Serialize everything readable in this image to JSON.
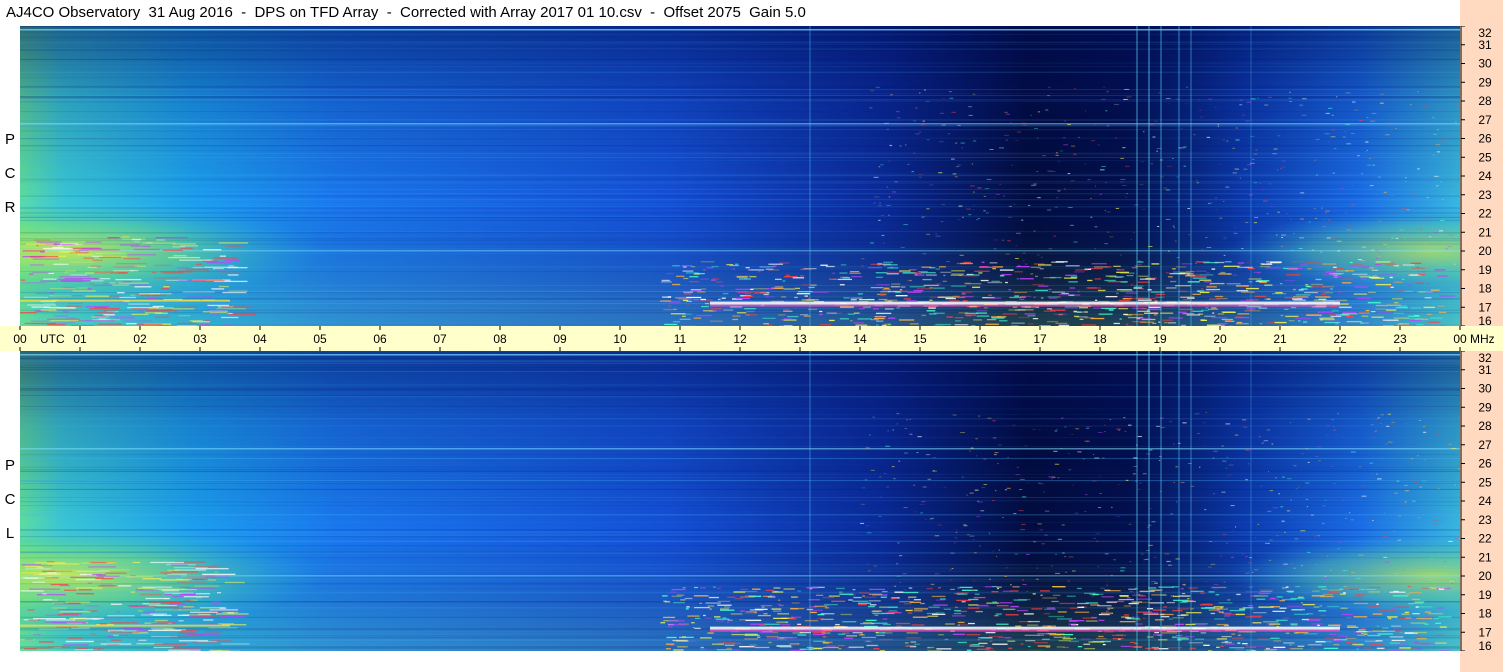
{
  "title": "AJ4CO Observatory  31 Aug 2016  -  DPS on TFD Array  -  Corrected with Array 2017 01 10.csv  -  Offset 2075  Gain 5.0",
  "colors": {
    "background": "#ffffff",
    "axis_strip": "#ffffcc",
    "freq_strip": "#ffd9c0",
    "spectro_base": "#1a66f0",
    "spectro_dark": "#000a40",
    "spectro_bright": "#e8f040"
  },
  "chart_data": [
    {
      "type": "heatmap",
      "polarization_label": "R C P",
      "polarization_letters": [
        "R",
        "C",
        "P"
      ],
      "x_unit": "UTC",
      "y_unit": "MHz",
      "xlim": [
        0,
        24
      ],
      "ylim": [
        16,
        32
      ],
      "x_ticks": [
        "00",
        "01",
        "02",
        "03",
        "04",
        "05",
        "06",
        "07",
        "08",
        "09",
        "10",
        "11",
        "12",
        "13",
        "14",
        "15",
        "16",
        "17",
        "18",
        "19",
        "20",
        "21",
        "22",
        "23",
        "00"
      ],
      "y_ticks": [
        "16",
        "17",
        "18",
        "19",
        "20",
        "21",
        "22",
        "23",
        "24",
        "25",
        "26",
        "27",
        "28",
        "29",
        "30",
        "31",
        "32"
      ],
      "colormap": "jet"
    },
    {
      "type": "heatmap",
      "polarization_label": "L C P",
      "polarization_letters": [
        "L",
        "C",
        "P"
      ],
      "x_unit": "UTC",
      "y_unit": "MHz",
      "xlim": [
        0,
        24
      ],
      "ylim": [
        16,
        32
      ],
      "x_ticks": [
        "00",
        "01",
        "02",
        "03",
        "04",
        "05",
        "06",
        "07",
        "08",
        "09",
        "10",
        "11",
        "12",
        "13",
        "14",
        "15",
        "16",
        "17",
        "18",
        "19",
        "20",
        "21",
        "22",
        "23",
        "00"
      ],
      "y_ticks": [
        "16",
        "17",
        "18",
        "19",
        "20",
        "21",
        "22",
        "23",
        "24",
        "25",
        "26",
        "27",
        "28",
        "29",
        "30",
        "31",
        "32"
      ],
      "colormap": "jet"
    }
  ]
}
